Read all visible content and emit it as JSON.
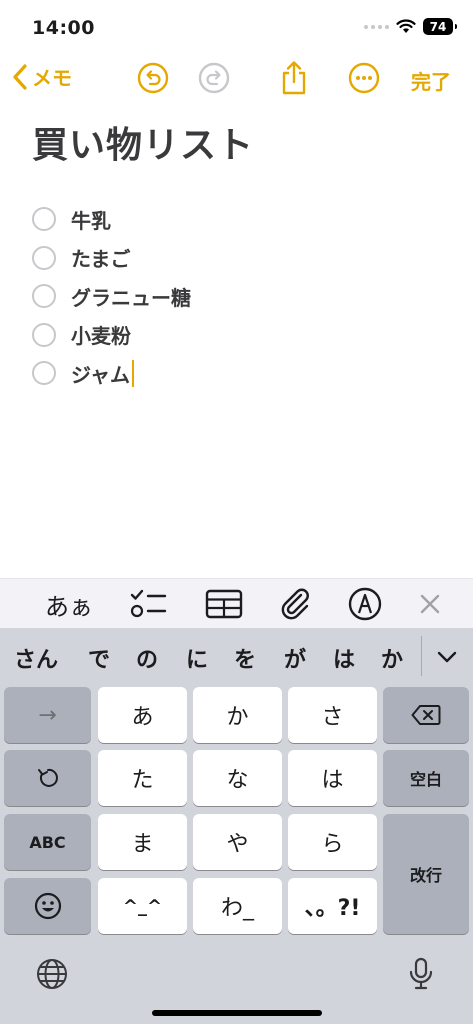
{
  "status": {
    "time": "14:00",
    "battery": "74"
  },
  "nav": {
    "back_label": "メモ",
    "done_label": "完了"
  },
  "note": {
    "title": "買い物リスト",
    "checklist": [
      "牛乳",
      "たまご",
      "グラニュー糖",
      "小麦粉",
      "ジャム"
    ]
  },
  "format_bar": {
    "text_style_label": "あぁ"
  },
  "keyboard": {
    "predictions": [
      "さん",
      "で",
      "の",
      "に",
      "を",
      "が",
      "は",
      "か"
    ],
    "keys": {
      "arrow": "→",
      "a": "あ",
      "ka": "か",
      "sa": "さ",
      "ta": "た",
      "na": "な",
      "ha": "は",
      "abc": "ABC",
      "ma": "ま",
      "ya": "や",
      "ra": "ら",
      "emoticon": "^_^",
      "wa": "わ_",
      "punct": "、。?!",
      "space": "空白",
      "return": "改行"
    }
  },
  "colors": {
    "accent": "#e5a800",
    "key_white": "#ffffff",
    "key_gray": "#abb0bb",
    "keyboard_bg": "#d1d4db"
  },
  "icons": [
    "chevron-left-icon",
    "undo-icon",
    "redo-icon",
    "share-icon",
    "more-icon",
    "checklist-icon",
    "table-icon",
    "paperclip-icon",
    "markup-icon",
    "close-icon",
    "delete-icon",
    "undo-key-icon",
    "emoji-icon",
    "globe-icon",
    "mic-icon",
    "chevron-down-icon",
    "wifi-icon"
  ]
}
